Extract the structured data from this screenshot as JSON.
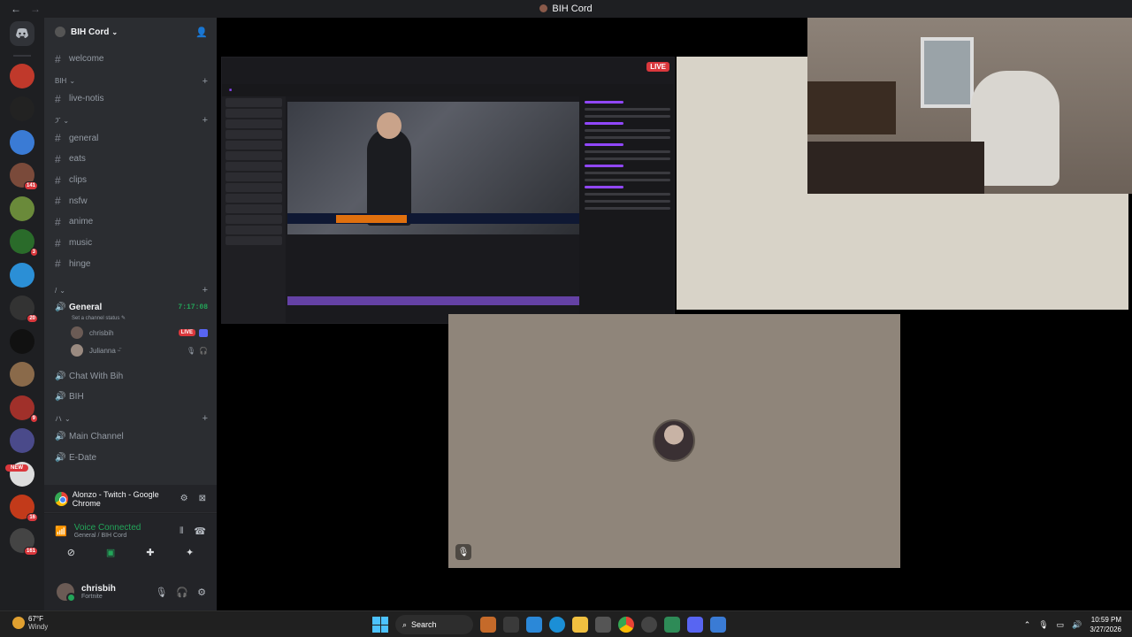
{
  "window": {
    "title": "BIH Cord"
  },
  "guild": {
    "name": "BIH Cord"
  },
  "channels_top": [
    {
      "name": "welcome"
    }
  ],
  "categories": {
    "bih": "BIH",
    "emoji_cat": "ፓ",
    "slash_cat": "/",
    "a_cat": "ハ"
  },
  "channels_bih": [
    {
      "name": "live-notis"
    }
  ],
  "channels_text": [
    {
      "name": "general"
    },
    {
      "name": "eats"
    },
    {
      "name": "clips"
    },
    {
      "name": "nsfw"
    },
    {
      "name": "anime"
    },
    {
      "name": "music"
    },
    {
      "name": "hinge"
    }
  ],
  "voice": {
    "active_channel": "General",
    "timer": "7:17:08",
    "status_placeholder": "Set a channel status",
    "users": [
      {
        "name": "chrisbih",
        "live": "LIVE"
      },
      {
        "name": "Julianna",
        "suffix": "ᵕ̈"
      }
    ],
    "other_channels": [
      "Chat With Bih",
      "BIH"
    ],
    "more_channels": [
      "Main Channel",
      "E-Date"
    ]
  },
  "stream_panel": {
    "label": "Alonzo - Twitch - Google Chrome"
  },
  "voice_panel": {
    "status": "Voice Connected",
    "location": "General / BIH Cord"
  },
  "user_panel": {
    "name": "chrisbih",
    "activity": "Fortnite"
  },
  "stage": {
    "live_label": "LIVE"
  },
  "rail": {
    "badges": [
      "141",
      "3",
      "20",
      "9",
      "16",
      "161"
    ],
    "new_label": "NEW"
  },
  "taskbar": {
    "temp": "67°F",
    "weather": "Windy",
    "search": "Search",
    "time": "10:59 PM",
    "date": "3/27/2026"
  },
  "colors": {
    "discord_bg": "#2b2d31",
    "rail_bg": "#1e1f22",
    "accent_green": "#23a559",
    "live_red": "#da373c",
    "blurple": "#5865f2"
  }
}
